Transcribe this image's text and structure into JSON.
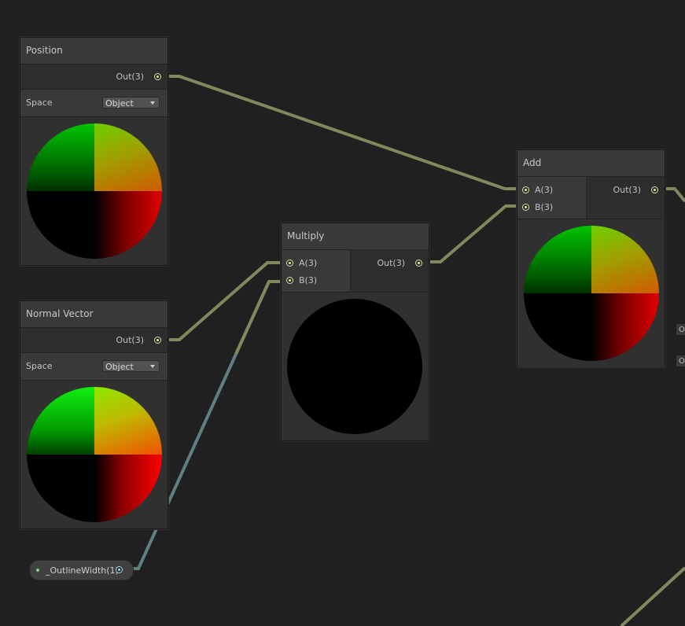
{
  "nodes": {
    "position": {
      "title": "Position",
      "output": "Out(3)",
      "space_label": "Space",
      "space_value": "Object"
    },
    "normal_vector": {
      "title": "Normal Vector",
      "output": "Out(3)",
      "space_label": "Space",
      "space_value": "Object"
    },
    "multiply": {
      "title": "Multiply",
      "input_a": "A(3)",
      "input_b": "B(3)",
      "output": "Out(3)"
    },
    "add": {
      "title": "Add",
      "input_a": "A(3)",
      "input_b": "B(3)",
      "output": "Out(3)"
    },
    "outline_width": {
      "label": "_OutlineWidth(1)"
    }
  },
  "offscreen_stubs": [
    "O",
    "O"
  ],
  "colors": {
    "canvas": "#202020",
    "node_bg": "#393939",
    "vector3_wire": "#7f8a5c",
    "float_wire": "#5f7f80",
    "vector3_port": "#e6f28a",
    "float_port": "#9de0f0"
  },
  "icons": [
    "dropdown-caret-icon",
    "port-dot-icon"
  ]
}
